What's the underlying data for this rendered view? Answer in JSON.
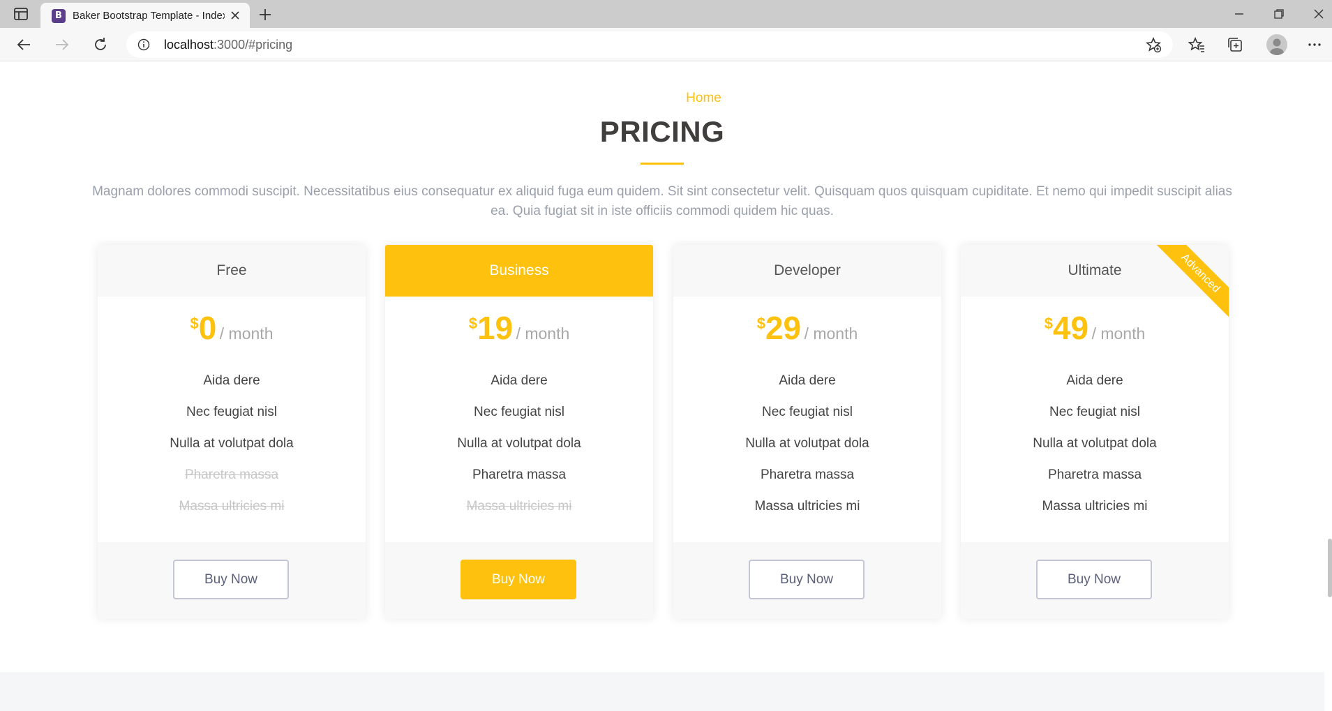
{
  "browser": {
    "tab_title": "Baker Bootstrap Template - Index",
    "favicon_letter": "B",
    "url_host": "localhost",
    "url_rest": ":3000/#pricing"
  },
  "section": {
    "breadcrumb": "Home",
    "title": "PRICING",
    "description": "Magnam dolores commodi suscipit. Necessitatibus eius consequatur ex aliquid fuga eum quidem. Sit sint consectetur velit. Quisquam quos quisquam cupiditate. Et nemo qui impedit suscipit alias ea. Quia fugiat sit in iste officiis commodi quidem hic quas."
  },
  "accent_color": "#fdc10e",
  "plans": [
    {
      "name": "Free",
      "currency": "$",
      "amount": "0",
      "period": "/ month",
      "features": [
        {
          "label": "Aida dere",
          "available": true
        },
        {
          "label": "Nec feugiat nisl",
          "available": true
        },
        {
          "label": "Nulla at volutpat dola",
          "available": true
        },
        {
          "label": "Pharetra massa",
          "available": false
        },
        {
          "label": "Massa ultricies mi",
          "available": false
        }
      ],
      "button": "Buy Now"
    },
    {
      "name": "Business",
      "currency": "$",
      "amount": "19",
      "period": "/ month",
      "features": [
        {
          "label": "Aida dere",
          "available": true
        },
        {
          "label": "Nec feugiat nisl",
          "available": true
        },
        {
          "label": "Nulla at volutpat dola",
          "available": true
        },
        {
          "label": "Pharetra massa",
          "available": true
        },
        {
          "label": "Massa ultricies mi",
          "available": false
        }
      ],
      "button": "Buy Now"
    },
    {
      "name": "Developer",
      "currency": "$",
      "amount": "29",
      "period": "/ month",
      "features": [
        {
          "label": "Aida dere",
          "available": true
        },
        {
          "label": "Nec feugiat nisl",
          "available": true
        },
        {
          "label": "Nulla at volutpat dola",
          "available": true
        },
        {
          "label": "Pharetra massa",
          "available": true
        },
        {
          "label": "Massa ultricies mi",
          "available": true
        }
      ],
      "button": "Buy Now"
    },
    {
      "name": "Ultimate",
      "currency": "$",
      "amount": "49",
      "period": "/ month",
      "ribbon": "Advanced",
      "features": [
        {
          "label": "Aida dere",
          "available": true
        },
        {
          "label": "Nec feugiat nisl",
          "available": true
        },
        {
          "label": "Nulla at volutpat dola",
          "available": true
        },
        {
          "label": "Pharetra massa",
          "available": true
        },
        {
          "label": "Massa ultricies mi",
          "available": true
        }
      ],
      "button": "Buy Now"
    }
  ]
}
